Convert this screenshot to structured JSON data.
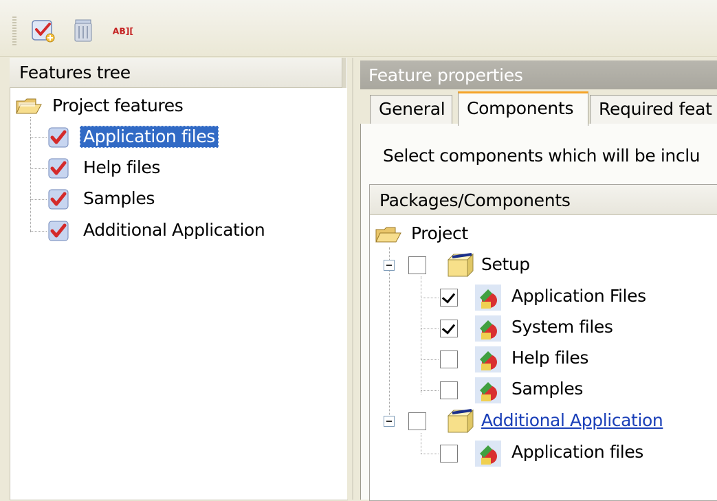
{
  "toolbar": {
    "buttons": [
      {
        "name": "new-feature-icon"
      },
      {
        "name": "delete-icon"
      },
      {
        "name": "rename-icon",
        "glyph": "AB]["
      }
    ]
  },
  "features_tree": {
    "header": "Features tree",
    "root": "Project features",
    "items": [
      "Application files",
      "Help files",
      "Samples",
      "Additional Application"
    ],
    "selected_index": 0
  },
  "feature_properties": {
    "title": "Feature properties",
    "tabs": [
      "General",
      "Components",
      "Required feat"
    ],
    "active_tab": 1,
    "description": "Select components which will be inclu",
    "packages": {
      "header": "Packages/Components",
      "root": "Project",
      "groups": [
        {
          "label": "Setup",
          "checked": false,
          "children": [
            {
              "label": "Application Files",
              "checked": true
            },
            {
              "label": "System files",
              "checked": true
            },
            {
              "label": "Help files",
              "checked": false
            },
            {
              "label": "Samples",
              "checked": false
            }
          ]
        },
        {
          "label": "Additional Application",
          "checked": false,
          "children": [
            {
              "label": "Application files",
              "checked": false
            }
          ]
        }
      ]
    }
  },
  "colors": {
    "selection": "#316ac5",
    "tab_accent": "#f5a327",
    "link": "#1a3fb8",
    "check_red": "#d42a2a"
  }
}
